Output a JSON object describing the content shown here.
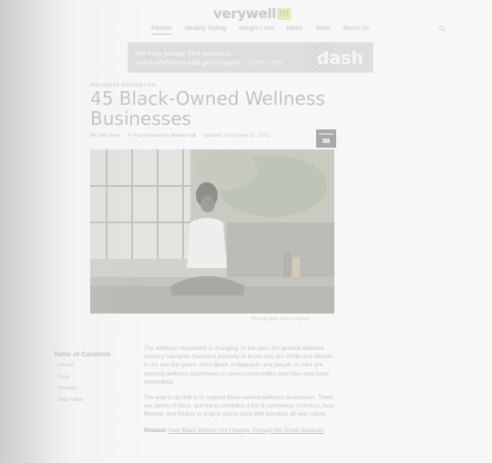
{
  "header": {
    "logo_main": "verywell",
    "logo_badge": "fit",
    "nav": [
      {
        "label": "Fitness",
        "active": true
      },
      {
        "label": "Healthy Eating",
        "active": false
      },
      {
        "label": "Weight Loss",
        "active": false
      },
      {
        "label": "News",
        "active": false
      },
      {
        "label": "Tools",
        "active": false
      },
      {
        "label": "About Us",
        "active": false
      }
    ]
  },
  "ad": {
    "line1": "We help people find answers,",
    "line2": "solve problems and get inspired.",
    "more": "LEARN MORE",
    "brand": "dash"
  },
  "article": {
    "breadcrumb": "WELLNESS INSPIRATION",
    "title": "45 Black-Owned Wellness Businesses",
    "author": "By Julia Sims",
    "fact_check": "Fact checked by Marley Hall",
    "updated": "Updated on October 31, 2021",
    "caption": "Photo by Santi Vedri / Unsplash"
  },
  "toc": {
    "title": "Table of Contents",
    "items": [
      "Fitness",
      "Food",
      "Lifestyle",
      "Daily Vibes"
    ]
  },
  "body": {
    "p1": "The wellness movement is changing. In the past, the general wellness industry has been marketed primarily to those who are White and affluent. In the last few years, more Black, Indigenous, and people of color are opening wellness businesses to serve communities that have long been overlooked.",
    "p2": "The way to do that is to support Black-owned wellness businesses. There are plenty of them, and we've compiled a list of companies in fitness, food, lifestyle, and beauty to inspire you to shop with intention all year round.",
    "p3_label": "Related:",
    "p3_link": "How Black Women Are Healing Through the Great Outdoors"
  },
  "colors": {
    "background": "#f7f7f7",
    "brand_accent": "#d8d8a8"
  }
}
